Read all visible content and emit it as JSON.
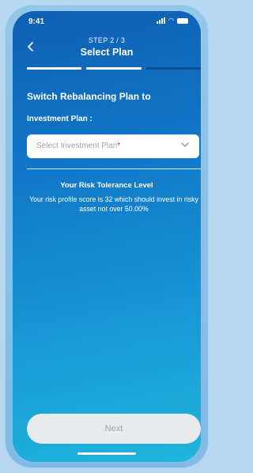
{
  "status_bar": {
    "time": "9:41"
  },
  "header": {
    "step": "STEP 2 / 3",
    "title": "Select Plan",
    "back_icon": "chevron-left"
  },
  "progress": {
    "current_step": 2,
    "total_steps": 3
  },
  "form": {
    "heading": "Switch Rebalancing Plan to",
    "label": "Investment Plan :",
    "select": {
      "placeholder": "Select Investment Plan",
      "required_marker": "*",
      "icon": "chevron-down"
    }
  },
  "risk": {
    "title": "Your Risk Tolerance Level",
    "description": "Your risk profile score is 32 which should invest in risky asset not over 50.00%"
  },
  "footer": {
    "next_label": "Next"
  },
  "colors": {
    "background_top": "#0f5fb3",
    "background_bottom": "#1fb5dc",
    "required": "#d9232e",
    "button_disabled": "#e8eaec"
  }
}
